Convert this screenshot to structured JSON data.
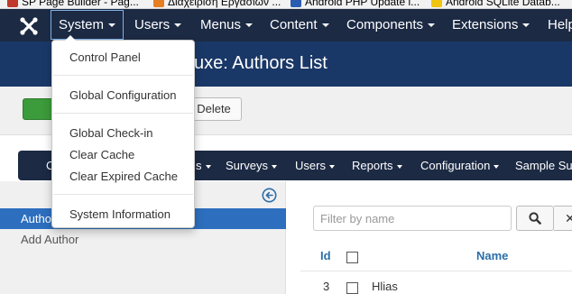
{
  "browser": {
    "bookmarks": [
      {
        "label": "SP Page Builder - Pag...",
        "color": "#c0392b"
      },
      {
        "label": "Διαχείριση Εργασιών ...",
        "color": "#e67e22"
      },
      {
        "label": "Android PHP Update l...",
        "color": "#2a5db0"
      },
      {
        "label": "Android SQLite Datab...",
        "color": "#f1c40f"
      }
    ]
  },
  "topnav": {
    "items": [
      "System",
      "Users",
      "Menus",
      "Content",
      "Components",
      "Extensions",
      "Help"
    ]
  },
  "header": {
    "title": "uxe: Authors List"
  },
  "toolbar": {
    "delete_label": "Delete"
  },
  "subnav": {
    "items": [
      "C",
      "s",
      "Surveys",
      "Users",
      "Reports",
      "Configuration",
      "Sample Su"
    ]
  },
  "sidebar": {
    "active_item": "Authors",
    "items": [
      "Add Author"
    ]
  },
  "filter": {
    "placeholder": "Filter by name"
  },
  "table": {
    "headers": {
      "id": "Id",
      "name": "Name"
    },
    "rows": [
      {
        "id": "3",
        "name": "Hlias"
      }
    ]
  },
  "system_menu": {
    "items": [
      "Control Panel",
      "Global Configuration",
      "Global Check-in",
      "Clear Cache",
      "Clear Expired Cache",
      "System Information"
    ]
  },
  "colors": {
    "navbar": "#1c2a44",
    "header": "#1a3867",
    "active_sidebar": "#2d6fbe",
    "link": "#2b6ea9",
    "success": "#3c9b3b"
  }
}
